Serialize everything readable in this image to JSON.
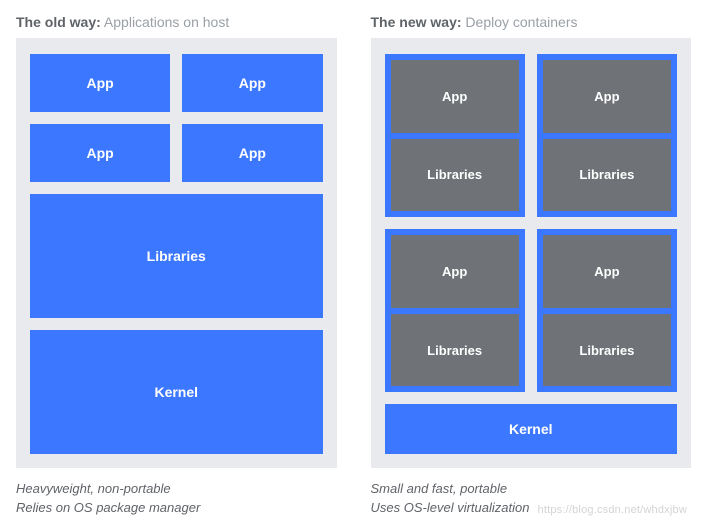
{
  "left": {
    "heading_bold": "The old way:",
    "heading_rest": "Applications on host",
    "apps": [
      "App",
      "App",
      "App",
      "App"
    ],
    "libraries": "Libraries",
    "kernel": "Kernel",
    "caption_line1": "Heavyweight, non-portable",
    "caption_line2": "Relies on OS package manager"
  },
  "right": {
    "heading_bold": "The new way:",
    "heading_rest": "Deploy containers",
    "containers": [
      {
        "app": "App",
        "lib": "Libraries"
      },
      {
        "app": "App",
        "lib": "Libraries"
      },
      {
        "app": "App",
        "lib": "Libraries"
      },
      {
        "app": "App",
        "lib": "Libraries"
      }
    ],
    "kernel": "Kernel",
    "caption_line1": "Small and fast, portable",
    "caption_line2": "Uses OS-level virtualization"
  },
  "watermark": "https://blog.csdn.net/whdxjbw"
}
